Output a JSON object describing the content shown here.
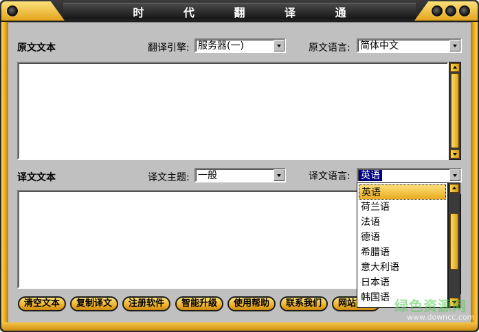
{
  "window": {
    "title": "时 代 翻 译 通"
  },
  "source": {
    "section_label": "原文文本",
    "engine_label": "翻译引擎:",
    "engine_value": "服务器(一)",
    "language_label": "原文语言:",
    "language_value": "简体中文",
    "text": ""
  },
  "target": {
    "section_label": "译文文本",
    "topic_label": "译文主题:",
    "topic_value": "一般",
    "language_label": "译文语言:",
    "language_value": "英语",
    "text": ""
  },
  "language_dropdown": {
    "options": [
      "英语",
      "荷兰语",
      "法语",
      "德语",
      "希腊语",
      "意大利语",
      "日本语",
      "韩国语"
    ],
    "highlighted_index": 0
  },
  "buttons": {
    "clear": "清空文本",
    "copy": "复制译文",
    "register": "注册软件",
    "upgrade": "智能升级",
    "help": "使用帮助",
    "contact": "联系我们",
    "website": "网站首页"
  },
  "watermark": {
    "text": "绿色资源网",
    "url": "www.downcc.com"
  },
  "colors": {
    "accent_gold": "#e9a91e",
    "frame_dark": "#2a2a2a",
    "client_gray": "#c0c0c0",
    "selection_navy": "#000080"
  }
}
